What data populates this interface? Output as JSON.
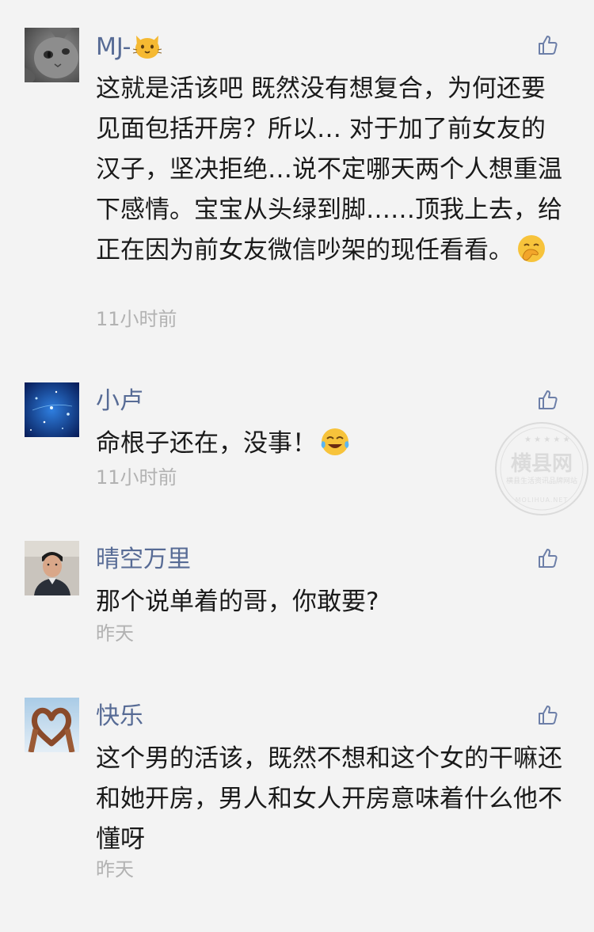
{
  "comments": [
    {
      "username": "MJ-",
      "username_emoji": "cat-face",
      "content": "这就是活该吧 既然没有想复合，为何还要见面包括开房？所以… 对于加了前女友的汉子，坚决拒绝…说不定哪天两个人想重温下感情。宝宝从头绿到脚……顶我上去，给正在因为前女友微信吵架的现任看看。",
      "content_emoji": "hand-over-mouth-face",
      "time": "11小时前"
    },
    {
      "username": "小卢",
      "content": "命根子还在，没事！",
      "content_emoji": "tears-of-joy-face",
      "time": "11小时前"
    },
    {
      "username": "晴空万里",
      "content": "那个说单着的哥，你敢要?",
      "time": "昨天"
    },
    {
      "username": "快乐",
      "content": "这个男的活该，既然不想和这个女的干嘛还和她开房，男人和女人开房意味着什么他不懂呀",
      "time": "昨天"
    }
  ],
  "watermark": {
    "title": "横县网",
    "subtitle": "横县生活资讯品牌网站",
    "url": "MOLIHUA.NET"
  },
  "colors": {
    "username": "#576b95",
    "content": "#1a1a1a",
    "time": "#b2b2b2",
    "background": "#f3f3f3"
  }
}
